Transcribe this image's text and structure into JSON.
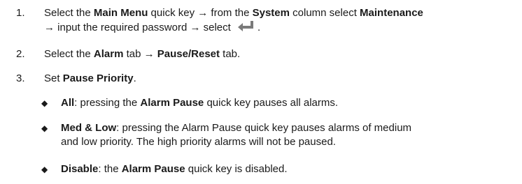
{
  "steps": [
    {
      "number": "1.",
      "t1": "Select the ",
      "b1": "Main Menu",
      "t2": " quick key → from the ",
      "b2": "System",
      "t3": " column select ",
      "b3": "Maintenance",
      "t4": "→ input the required password → select ",
      "t5": ".",
      "icon": "enter-key-icon"
    },
    {
      "number": "2.",
      "t1": "Select the ",
      "b1": "Alarm",
      "t2": " tab → ",
      "b2": "Pause/Reset",
      "t3": " tab."
    },
    {
      "number": "3.",
      "t1": "Set ",
      "b1": "Pause Priority",
      "t2": "."
    }
  ],
  "options": [
    {
      "marker": "◆",
      "b1": "All",
      "t1": ": pressing the ",
      "b2": "Alarm Pause",
      "t2": " quick key pauses all alarms."
    },
    {
      "marker": "◆",
      "b1": "Med & Low",
      "t1": ": pressing the Alarm Pause quick key pauses alarms of medium",
      "t2": "and low priority. The high priority alarms will not be paused."
    },
    {
      "marker": "◆",
      "b1": "Disable",
      "t1": ": the ",
      "b2": "Alarm Pause",
      "t2": " quick key is disabled."
    }
  ],
  "colors": {
    "text": "#1a1a1a",
    "icon": "#7a7a7a"
  }
}
